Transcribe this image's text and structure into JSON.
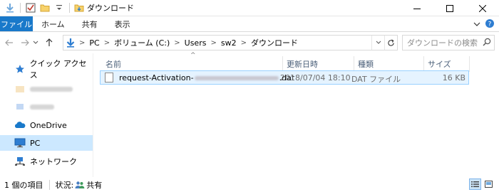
{
  "window": {
    "title": "ダウンロード",
    "controls": {
      "minimize": "minimize",
      "maximize": "maximize",
      "close": "close"
    }
  },
  "ribbon": {
    "file_tab": "ファイル",
    "tabs": [
      "ホーム",
      "共有",
      "表示"
    ]
  },
  "address": {
    "segments": [
      "PC",
      "ボリューム (C:)",
      "Users",
      "sw2",
      "ダウンロード"
    ]
  },
  "search": {
    "placeholder": "ダウンロードの検索"
  },
  "nav": {
    "items": [
      {
        "label": "クイック アクセス"
      },
      {
        "label": ""
      },
      {
        "label": ""
      },
      {
        "label": "OneDrive"
      },
      {
        "label": "PC"
      },
      {
        "label": "ネットワーク"
      }
    ]
  },
  "columns": {
    "name": "名前",
    "modified": "更新日時",
    "type": "種類",
    "size": "サイズ"
  },
  "files": [
    {
      "name_prefix": "request-Activation-",
      "name_suffix": "dat",
      "modified": "2018/07/04 18:10",
      "type": "DAT ファイル",
      "size": "16 KB"
    }
  ],
  "status": {
    "item_count": "1 個の項目",
    "state_label": "状況:",
    "state_value": "共有"
  },
  "colors": {
    "accent": "#1979ca",
    "selection": "#cce8ff",
    "row_select": "#e5f3ff",
    "header_text": "#4c607a"
  }
}
